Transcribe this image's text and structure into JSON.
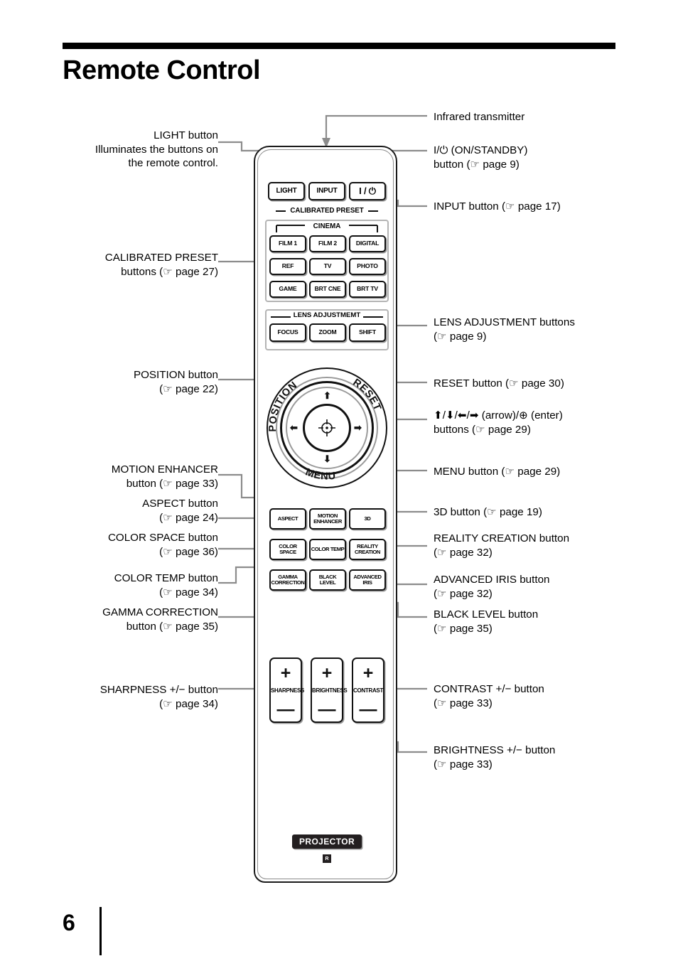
{
  "header": {
    "title": "Remote Control"
  },
  "footer": {
    "page_number": "6"
  },
  "remote": {
    "top_keys": [
      {
        "id": "light",
        "label": "LIGHT"
      },
      {
        "id": "input",
        "label": "INPUT"
      },
      {
        "id": "power",
        "label": "I / ⏻"
      }
    ],
    "calibrated_preset": {
      "section_label": "CALIBRATED PRESET",
      "cinema_label": "CINEMA",
      "keys": [
        {
          "id": "film1",
          "label": "FILM 1"
        },
        {
          "id": "film2",
          "label": "FILM 2"
        },
        {
          "id": "digital",
          "label": "DIGITAL"
        },
        {
          "id": "ref",
          "label": "REF"
        },
        {
          "id": "tv",
          "label": "TV"
        },
        {
          "id": "photo",
          "label": "PHOTO"
        },
        {
          "id": "game",
          "label": "GAME"
        },
        {
          "id": "brtcne",
          "label": "BRT CNE"
        },
        {
          "id": "brttv",
          "label": "BRT TV"
        }
      ]
    },
    "lens_adjustment": {
      "section_label": "LENS ADJUSTMEMT",
      "keys": [
        {
          "id": "focus",
          "label": "FOCUS"
        },
        {
          "id": "zoom",
          "label": "ZOOM"
        },
        {
          "id": "shift",
          "label": "SHIFT"
        }
      ]
    },
    "navpad": {
      "position_label": "POSITION",
      "reset_label": "RESET",
      "menu_label": "MENU",
      "arrow_up": "⬆",
      "arrow_down": "⬇",
      "arrow_left": "⬅",
      "arrow_right": "➡"
    },
    "picture_keys": [
      {
        "id": "aspect",
        "label": "ASPECT"
      },
      {
        "id": "motion-enhancer",
        "label": "MOTION\nENHANCER"
      },
      {
        "id": "3d",
        "label": "3D"
      },
      {
        "id": "color-space",
        "label": "COLOR\nSPACE"
      },
      {
        "id": "color-temp",
        "label": "COLOR\nTEMP"
      },
      {
        "id": "reality-creation",
        "label": "REALITY\nCREATION"
      },
      {
        "id": "gamma-correction",
        "label": "GAMMA\nCORRECTION"
      },
      {
        "id": "black-level",
        "label": "BLACK\nLEVEL"
      },
      {
        "id": "advanced-iris",
        "label": "ADVANCED\nIRIS"
      }
    ],
    "rockers": [
      {
        "id": "sharpness",
        "label": "SHARPNESS",
        "plus": "+",
        "minus": "—"
      },
      {
        "id": "brightness",
        "label": "BRIGHTNESS",
        "plus": "+",
        "minus": "—"
      },
      {
        "id": "contrast",
        "label": "CONTRAST",
        "plus": "+",
        "minus": "—"
      }
    ],
    "badge": "PROJECTOR",
    "model_mark": "R"
  },
  "callouts": {
    "left": [
      {
        "id": "light",
        "text": "LIGHT button\nIlluminates the buttons on\nthe remote control."
      },
      {
        "id": "calibrated-preset",
        "text": "CALIBRATED PRESET\nbuttons (☞ page 27)"
      },
      {
        "id": "position",
        "text": "POSITION button\n(☞ page 22)"
      },
      {
        "id": "motion-enhancer",
        "text": "MOTION ENHANCER\nbutton (☞ page 33)"
      },
      {
        "id": "aspect",
        "text": "ASPECT button\n(☞ page 24)"
      },
      {
        "id": "color-space",
        "text": "COLOR SPACE button\n(☞ page 36)"
      },
      {
        "id": "color-temp",
        "text": "COLOR TEMP button\n(☞ page 34)"
      },
      {
        "id": "gamma-correction",
        "text": "GAMMA CORRECTION\nbutton (☞ page 35)"
      },
      {
        "id": "sharpness",
        "text": "SHARPNESS +/− button\n(☞ page 34)"
      }
    ],
    "right": [
      {
        "id": "infrared",
        "text": "Infrared transmitter"
      },
      {
        "id": "power",
        "text": "I/⏻ (ON/STANDBY)\nbutton (☞ page 9)"
      },
      {
        "id": "input",
        "text": "INPUT button (☞ page 17)"
      },
      {
        "id": "lens-adjustment",
        "text": "LENS ADJUSTMENT buttons\n(☞ page 9)"
      },
      {
        "id": "reset",
        "text": "RESET button (☞ page 30)"
      },
      {
        "id": "arrows",
        "text": "⬆/⬇/⬅/➡ (arrow)/⊕ (enter)\nbuttons (☞ page 29)"
      },
      {
        "id": "menu",
        "text": "MENU button (☞ page 29)"
      },
      {
        "id": "3d",
        "text": "3D button (☞ page 19)"
      },
      {
        "id": "reality-creation",
        "text": "REALITY CREATION button\n(☞ page 32)"
      },
      {
        "id": "advanced-iris",
        "text": "ADVANCED IRIS button\n(☞ page 32)"
      },
      {
        "id": "black-level",
        "text": "BLACK LEVEL button\n(☞ page 35)"
      },
      {
        "id": "contrast",
        "text": "CONTRAST +/− button\n(☞ page 33)"
      },
      {
        "id": "brightness",
        "text": "BRIGHTNESS +/− button\n(☞ page 33)"
      }
    ]
  },
  "colors": {
    "ink": "#000000",
    "leader": "#8c8c8c",
    "badge_bg": "#231f20",
    "frame": "#b4b4b4"
  }
}
